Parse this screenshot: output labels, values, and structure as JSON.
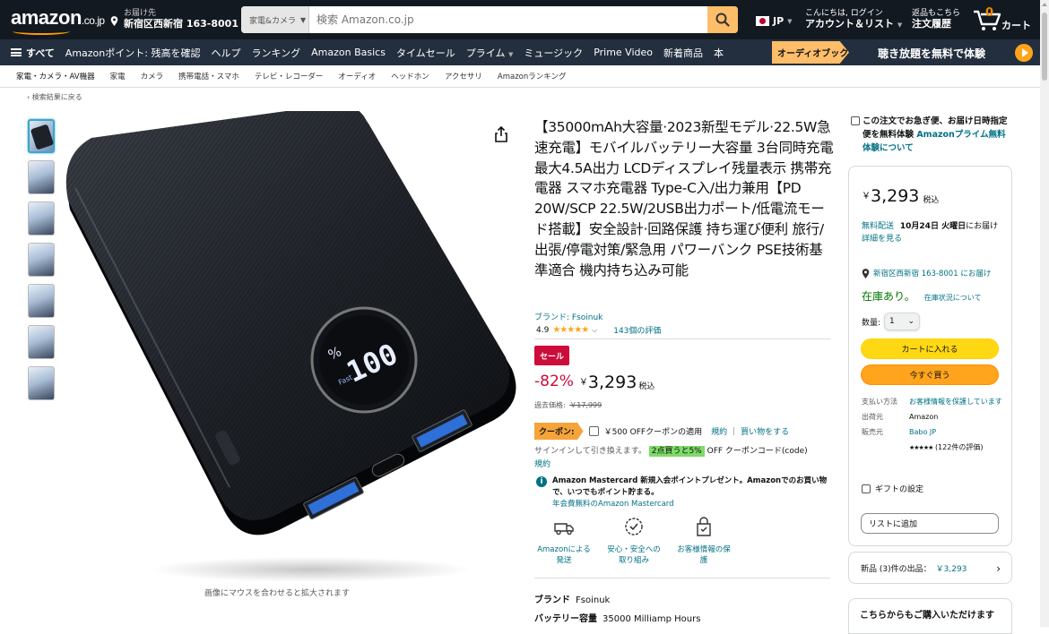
{
  "header": {
    "logo": "amazon",
    "logo_suffix": ".co.jp",
    "deliver_label": "お届け先",
    "deliver_location": "新宿区西新宿 163-8001",
    "search_category": "家電&カメラ",
    "search_placeholder": "検索 Amazon.co.jp",
    "language": "JP",
    "account_greeting": "こんにちは, ログイン",
    "account_label": "アカウント＆リスト",
    "returns_label": "返品もこちら",
    "orders_label": "注文履歴",
    "cart_count": "0",
    "cart_label": "カート"
  },
  "main_nav": {
    "all_label": "すべて",
    "items": [
      "Amazonポイント: 残高を確認",
      "ヘルプ",
      "ランキング",
      "Amazon Basics",
      "タイムセール",
      "プライム",
      "ミュージック",
      "Prime Video",
      "新着商品",
      "本"
    ],
    "promo_tag": "オーディオブック",
    "promo_text": "聴き放題を無料で体験"
  },
  "sub_nav": [
    "家電・カメラ・AV機器",
    "家電",
    "カメラ",
    "携帯電話・スマホ",
    "テレビ・レコーダー",
    "オーディオ",
    "ヘッドホン",
    "アクセサリ",
    "Amazonランキング"
  ],
  "breadcrumb": "‹ 検索結果に戻る",
  "gallery": {
    "hint": "画像にマウスを合わせると拡大されます",
    "display_reading": "100"
  },
  "product": {
    "title": "【35000mAh大容量·2023新型モデル·22.5W急速充電】モバイルバッテリー大容量 3台同時充電 最大4.5A出力 LCDディスプレイ残量表示 携帯充電器 スマホ充電器 Type-C入/出力兼用【PD 20W/SCP 22.5W/2USB出力ポート/低電流モード搭載】安全設計·回路保護 持ち運び便利 旅行/出張/停電対策/緊急用 パワーバンク PSE技術基準適合 機内持ち込み可能",
    "brand": "ブランド: Fsoinuk",
    "rating_value": "4.9",
    "stars": "★★★★★",
    "rating_count": "143個の評価",
    "sale_badge": "セール",
    "discount": "-82%",
    "currency": "￥",
    "price": "3,293",
    "tax": "税込",
    "list_price_label": "過去価格:",
    "list_price": "￥17,999",
    "coupon_badge": "クーポン:",
    "coupon_text": "￥500 OFFクーポンの適用",
    "coupon_terms": "規約",
    "coupon_sep": "|",
    "coupon_shop": "買い物をする",
    "promo_signin": "サインインして引き換えます。",
    "promo_highlight": "2点買うと5%",
    "promo_rest": "OFF クーポンコード(code)",
    "promo_terms": "規約",
    "mc_text": "Amazon Mastercard 新規入会ポイントプレゼント。Amazonでのお買い物で、いつでもポイント貯まる。",
    "mc_link": "年会費無料のAmazon Mastercard",
    "features": [
      {
        "icon": "delivery-icon",
        "label": "Amazonによる発送"
      },
      {
        "icon": "shield-icon",
        "label": "安心・安全への取り組み"
      },
      {
        "icon": "secure-transaction-icon",
        "label": "お客様情報の保護"
      }
    ],
    "specs": [
      {
        "k": "ブランド",
        "v": "Fsoinuk"
      },
      {
        "k": "バッテリー容量",
        "v": "35000 Milliamp Hours"
      }
    ]
  },
  "buybox": {
    "prime_note_pre": "この注文でお急ぎ便、お届け日時指定便を無料体験",
    "prime_note_link": "Amazonプライム無料体験について",
    "currency": "￥",
    "price": "3,293",
    "tax": "税込",
    "delivery_free": "無料配送",
    "delivery_date": "10月24日 火曜日",
    "delivery_suffix": "にお届け",
    "delivery_details": "詳細を見る",
    "location": "新宿区西新宿 163-8001 にお届け",
    "stock": "在庫あり。",
    "stock_status": "在庫状況について",
    "qty_label": "数量:",
    "qty_value": "1",
    "add_to_cart": "カートに入れる",
    "buy_now": "今すぐ買う",
    "payment_label": "支払い方法",
    "payment_value": "お客様情報を保護しています",
    "ship_from_label": "出荷元",
    "ship_from_value": "Amazon",
    "seller_label": "販売元",
    "seller_value": "Babo JP",
    "seller_stars": "★★★★★",
    "seller_reviews": "(122件の評価)",
    "gift_label": "ギフトの設定",
    "list_button": "リストに追加",
    "new_offers_label": "新品 (3)件の出品：",
    "new_offers_price": "￥3,293",
    "also_buy": "こちらからもご購入いただけます"
  },
  "colors": {
    "nav_dark": "#131921",
    "nav_main": "#232f3e",
    "accent_orange": "#ff9900",
    "link": "#007185",
    "sale_red": "#cc0c39",
    "cart_yellow": "#ffd814",
    "buy_orange": "#ffa41c",
    "in_stock_green": "#007600"
  }
}
